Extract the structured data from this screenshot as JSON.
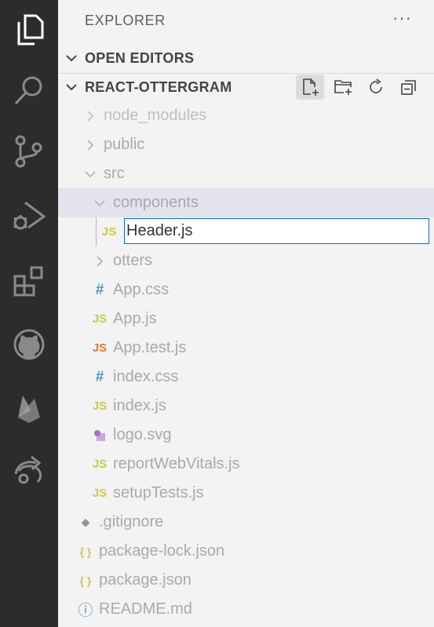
{
  "activity_bar": {
    "icons": [
      "files-icon",
      "search-icon",
      "source-control-icon",
      "run-debug-icon",
      "extensions-icon",
      "github-icon",
      "firebase-icon",
      "live-share-icon"
    ]
  },
  "sidebar": {
    "title": "EXPLORER",
    "more_label": "···",
    "open_editors_label": "OPEN EDITORS",
    "project_label": "REACT-OTTERGRAM",
    "toolbar": [
      "new-file-icon",
      "new-folder-icon",
      "refresh-icon",
      "collapse-all-icon"
    ]
  },
  "tree": {
    "node_modules": "node_modules",
    "public": "public",
    "src": "src",
    "components": "components",
    "rename_value": "Header.js",
    "otters": "otters",
    "app_css": "App.css",
    "app_js": "App.js",
    "app_test_js": "App.test.js",
    "index_css": "index.css",
    "index_js": "index.js",
    "logo_svg": "logo.svg",
    "report_web_vitals": "reportWebVitals.js",
    "setup_tests": "setupTests.js",
    "gitignore": ".gitignore",
    "package_lock": "package-lock.json",
    "package_json": "package.json",
    "readme": "README.md"
  },
  "file_icon_glyphs": {
    "js": "JS",
    "css": "#",
    "json": "{ }",
    "info": "ⓘ",
    "git": "◆"
  },
  "colors": {
    "js_icon": "#cbcb41",
    "css_icon": "#519aba",
    "test_js_icon": "#e37933",
    "json_icon": "#cbcb41",
    "svg_icon": "#a074c4",
    "readme_icon": "#519aba",
    "git_icon": "#41535b"
  }
}
